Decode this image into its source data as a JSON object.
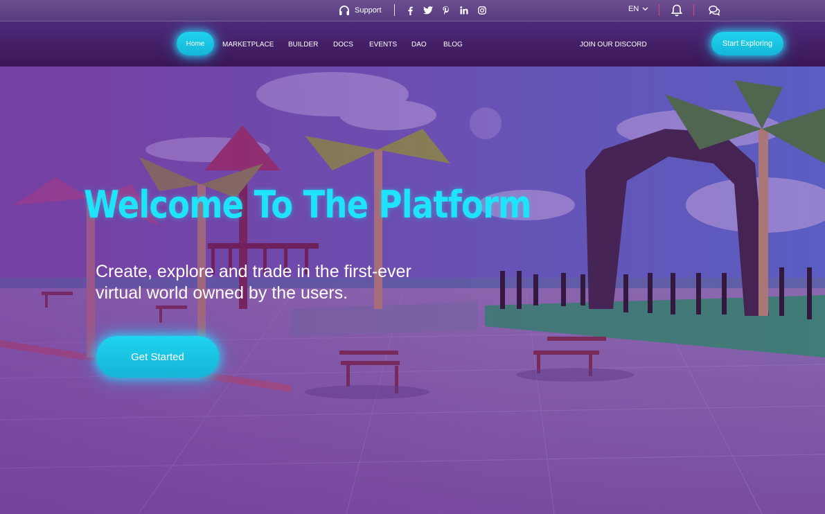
{
  "colors": {
    "accent": "#1fd3ee",
    "headline": "#1fe3f8",
    "divider_pink": "#e0486f"
  },
  "topbar": {
    "support_label": "Support",
    "support_icon": "headphones-icon",
    "social_icons": [
      "facebook-icon",
      "twitter-icon",
      "pinterest-icon",
      "linkedin-icon",
      "instagram-icon"
    ],
    "language": "EN",
    "notification_icon": "bell-icon",
    "chat_icon": "chat-icon"
  },
  "nav": {
    "home": "Home",
    "items": [
      "MARKETPLACE",
      "BUILDER",
      "DOCS",
      "EVENTS",
      "DAO",
      "BLOG"
    ],
    "discord": "JOIN OUR DISCORD",
    "cta": "Start Exploring"
  },
  "hero": {
    "title": "Welcome To The Platform",
    "subtitle_line1": "Create, explore and trade in the first-ever",
    "subtitle_line2": "virtual world owned by the users.",
    "button": "Get Started"
  }
}
